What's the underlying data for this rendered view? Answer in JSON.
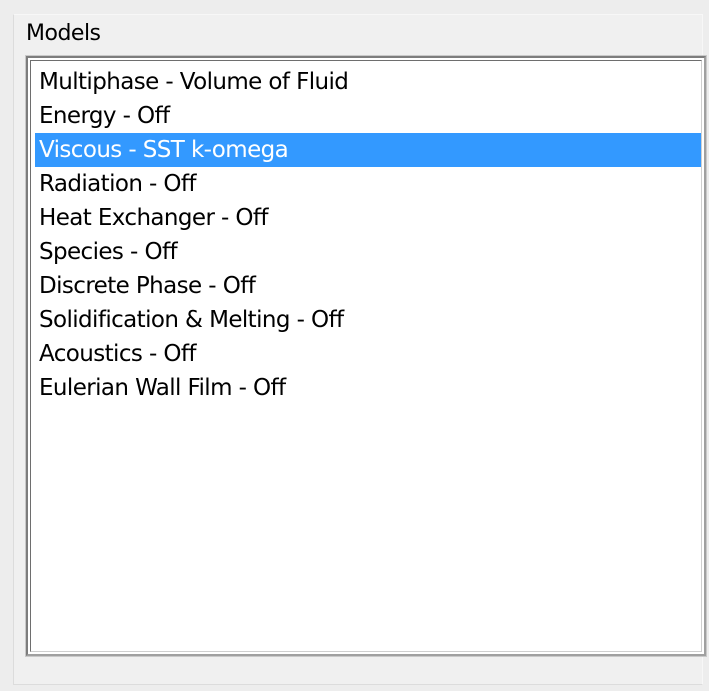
{
  "group": {
    "title": "Models"
  },
  "models": {
    "selected_index": 2,
    "colors": {
      "selection_bg": "#3399ff",
      "selection_fg": "#ffffff"
    },
    "items": [
      {
        "label": "Multiphase - Volume of Fluid"
      },
      {
        "label": "Energy - Off"
      },
      {
        "label": "Viscous - SST k-omega"
      },
      {
        "label": "Radiation - Off"
      },
      {
        "label": "Heat Exchanger - Off"
      },
      {
        "label": "Species - Off"
      },
      {
        "label": "Discrete Phase - Off"
      },
      {
        "label": "Solidification & Melting - Off"
      },
      {
        "label": "Acoustics - Off"
      },
      {
        "label": "Eulerian Wall Film - Off"
      }
    ]
  }
}
